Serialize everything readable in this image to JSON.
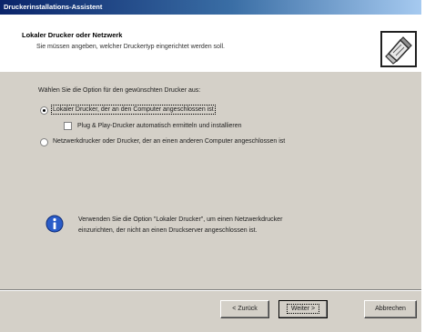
{
  "window": {
    "title": "Druckerinstallations-Assistent"
  },
  "header": {
    "title": "Lokaler Drucker oder Netzwerk",
    "subtitle": "Sie müssen angeben, welcher Druckertyp eingerichtet werden soll."
  },
  "content": {
    "prompt": "Wählen Sie die Option für den gewünschten Drucker aus:",
    "option_local": {
      "label": "Lokaler Drucker, der an den Computer angeschlossen ist",
      "selected": true
    },
    "plug_and_play": {
      "label": "Plug & Play-Drucker automatisch ermitteln und installieren",
      "checked": false
    },
    "option_network": {
      "label": "Netzwerkdrucker oder Drucker, der an einen anderen Computer angeschlossen ist",
      "selected": false
    },
    "info_line1": "Verwenden Sie die Option \"Lokaler Drucker\", um einen Netzwerkdrucker",
    "info_line2": "einzurichten, der nicht an einen Druckserver angeschlossen ist."
  },
  "buttons": {
    "back": "< Zurück",
    "next": "Weiter >",
    "cancel": "Abbrechen"
  },
  "icons": {
    "header": "printer-wizard-icon",
    "info": "info-icon"
  },
  "colors": {
    "titlebar_start": "#0a246a",
    "titlebar_end": "#a6caf0",
    "dialog_face": "#d4d0c8",
    "info_blue": "#2a5cc8"
  }
}
